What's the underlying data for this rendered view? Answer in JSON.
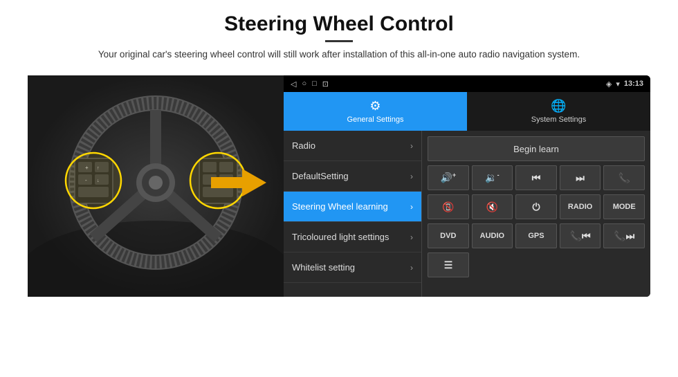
{
  "header": {
    "title": "Steering Wheel Control",
    "divider": true,
    "subtitle": "Your original car's steering wheel control will still work after installation of this all-in-one auto radio navigation system."
  },
  "status_bar": {
    "icons": [
      "◁",
      "○",
      "□",
      "⊡"
    ],
    "right_icons": [
      "♥",
      "▾"
    ],
    "time": "13:13"
  },
  "tabs": [
    {
      "id": "general",
      "label": "General Settings",
      "icon": "⚙",
      "active": true
    },
    {
      "id": "system",
      "label": "System Settings",
      "icon": "🌐",
      "active": false
    }
  ],
  "menu_items": [
    {
      "id": "radio",
      "label": "Radio",
      "active": false
    },
    {
      "id": "default",
      "label": "DefaultSetting",
      "active": false
    },
    {
      "id": "steering",
      "label": "Steering Wheel learning",
      "active": true
    },
    {
      "id": "tricoloured",
      "label": "Tricoloured light settings",
      "active": false
    },
    {
      "id": "whitelist",
      "label": "Whitelist setting",
      "active": false
    }
  ],
  "control_panel": {
    "begin_learn_label": "Begin learn",
    "row1": [
      {
        "id": "vol_up",
        "icon": "🔊+",
        "label": "vol-up"
      },
      {
        "id": "vol_down",
        "icon": "🔉-",
        "label": "vol-down"
      },
      {
        "id": "prev",
        "icon": "⏮",
        "label": "prev"
      },
      {
        "id": "next",
        "icon": "⏭",
        "label": "next"
      },
      {
        "id": "phone",
        "icon": "📞",
        "label": "phone"
      }
    ],
    "row2": [
      {
        "id": "call_end",
        "icon": "📵",
        "label": "call-end"
      },
      {
        "id": "mute",
        "icon": "🔇",
        "label": "mute"
      },
      {
        "id": "power",
        "icon": "⏻",
        "label": "power"
      },
      {
        "id": "radio_btn",
        "text": "RADIO",
        "label": "radio-btn"
      },
      {
        "id": "mode_btn",
        "text": "MODE",
        "label": "mode-btn"
      }
    ],
    "row3": [
      {
        "id": "dvd_btn",
        "text": "DVD",
        "label": "dvd-btn"
      },
      {
        "id": "audio_btn",
        "text": "AUDIO",
        "label": "audio-btn"
      },
      {
        "id": "gps_btn",
        "text": "GPS",
        "label": "gps-btn"
      },
      {
        "id": "tel_prev",
        "icon": "📞⏮",
        "label": "tel-prev"
      },
      {
        "id": "tel_next",
        "icon": "📞⏭",
        "label": "tel-next"
      }
    ],
    "row4": [
      {
        "id": "menu_icon",
        "icon": "☰",
        "label": "menu-icon"
      }
    ]
  }
}
